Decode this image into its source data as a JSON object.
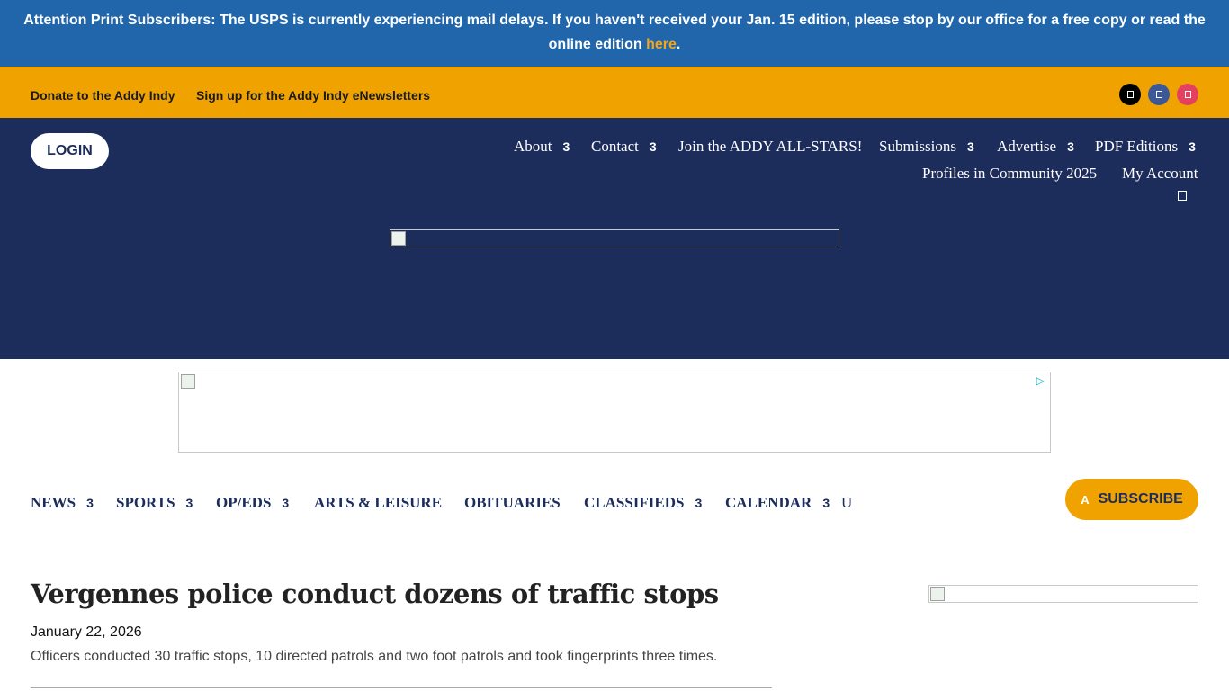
{
  "alert": {
    "text": "Attention Print Subscribers: The USPS is currently experiencing mail delays. If you haven't received your Jan. 15 edition, please stop by our office for a free copy or read the online edition ",
    "link_text": "here",
    "suffix": "."
  },
  "promo_links": [
    "Donate to the Addy Indy",
    "Sign up for the Addy Indy eNewsletters"
  ],
  "social": [
    {
      "icon": "x-twitter-icon",
      "color": "#000000"
    },
    {
      "icon": "facebook-icon",
      "color": "#3b5998"
    },
    {
      "icon": "instagram-icon",
      "color": "#e4405f"
    }
  ],
  "header": {
    "login_label": "LOGIN",
    "nav": [
      {
        "label": "About",
        "caret": "3"
      },
      {
        "label": "Contact",
        "caret": "3"
      },
      {
        "label": "Join the ADDY ALL-STARS!"
      },
      {
        "label": "Submissions",
        "caret": "3"
      },
      {
        "label": "Advertise",
        "caret": "3"
      },
      {
        "label": "PDF Editions",
        "caret": "3"
      },
      {
        "label": "Profiles in Community 2025"
      },
      {
        "label": "My Account"
      }
    ]
  },
  "main_nav": [
    {
      "label": "NEWS",
      "caret": "3"
    },
    {
      "label": "SPORTS",
      "caret": "3"
    },
    {
      "label": "OP/EDS",
      "caret": "3"
    },
    {
      "label": "ARTS & LEISURE"
    },
    {
      "label": "OBITUARIES"
    },
    {
      "label": "CLASSIFIEDS",
      "caret": "3"
    },
    {
      "label": "CALENDAR",
      "caret": "3"
    }
  ],
  "more_icon_text": "U",
  "subscribe": {
    "icon_text": "A",
    "label": "SUBSCRIBE"
  },
  "article": {
    "title": "Vergennes police conduct dozens of traffic stops",
    "date": "January 22, 2026",
    "summary": "Officers conducted 30 traffic stops, 10 directed patrols and two foot patrols and took fingerprints three times."
  },
  "colors": {
    "navy": "#1c2c5b",
    "blue": "#2166aa",
    "gold": "#f0a300",
    "link_gold": "#f3a51c"
  }
}
